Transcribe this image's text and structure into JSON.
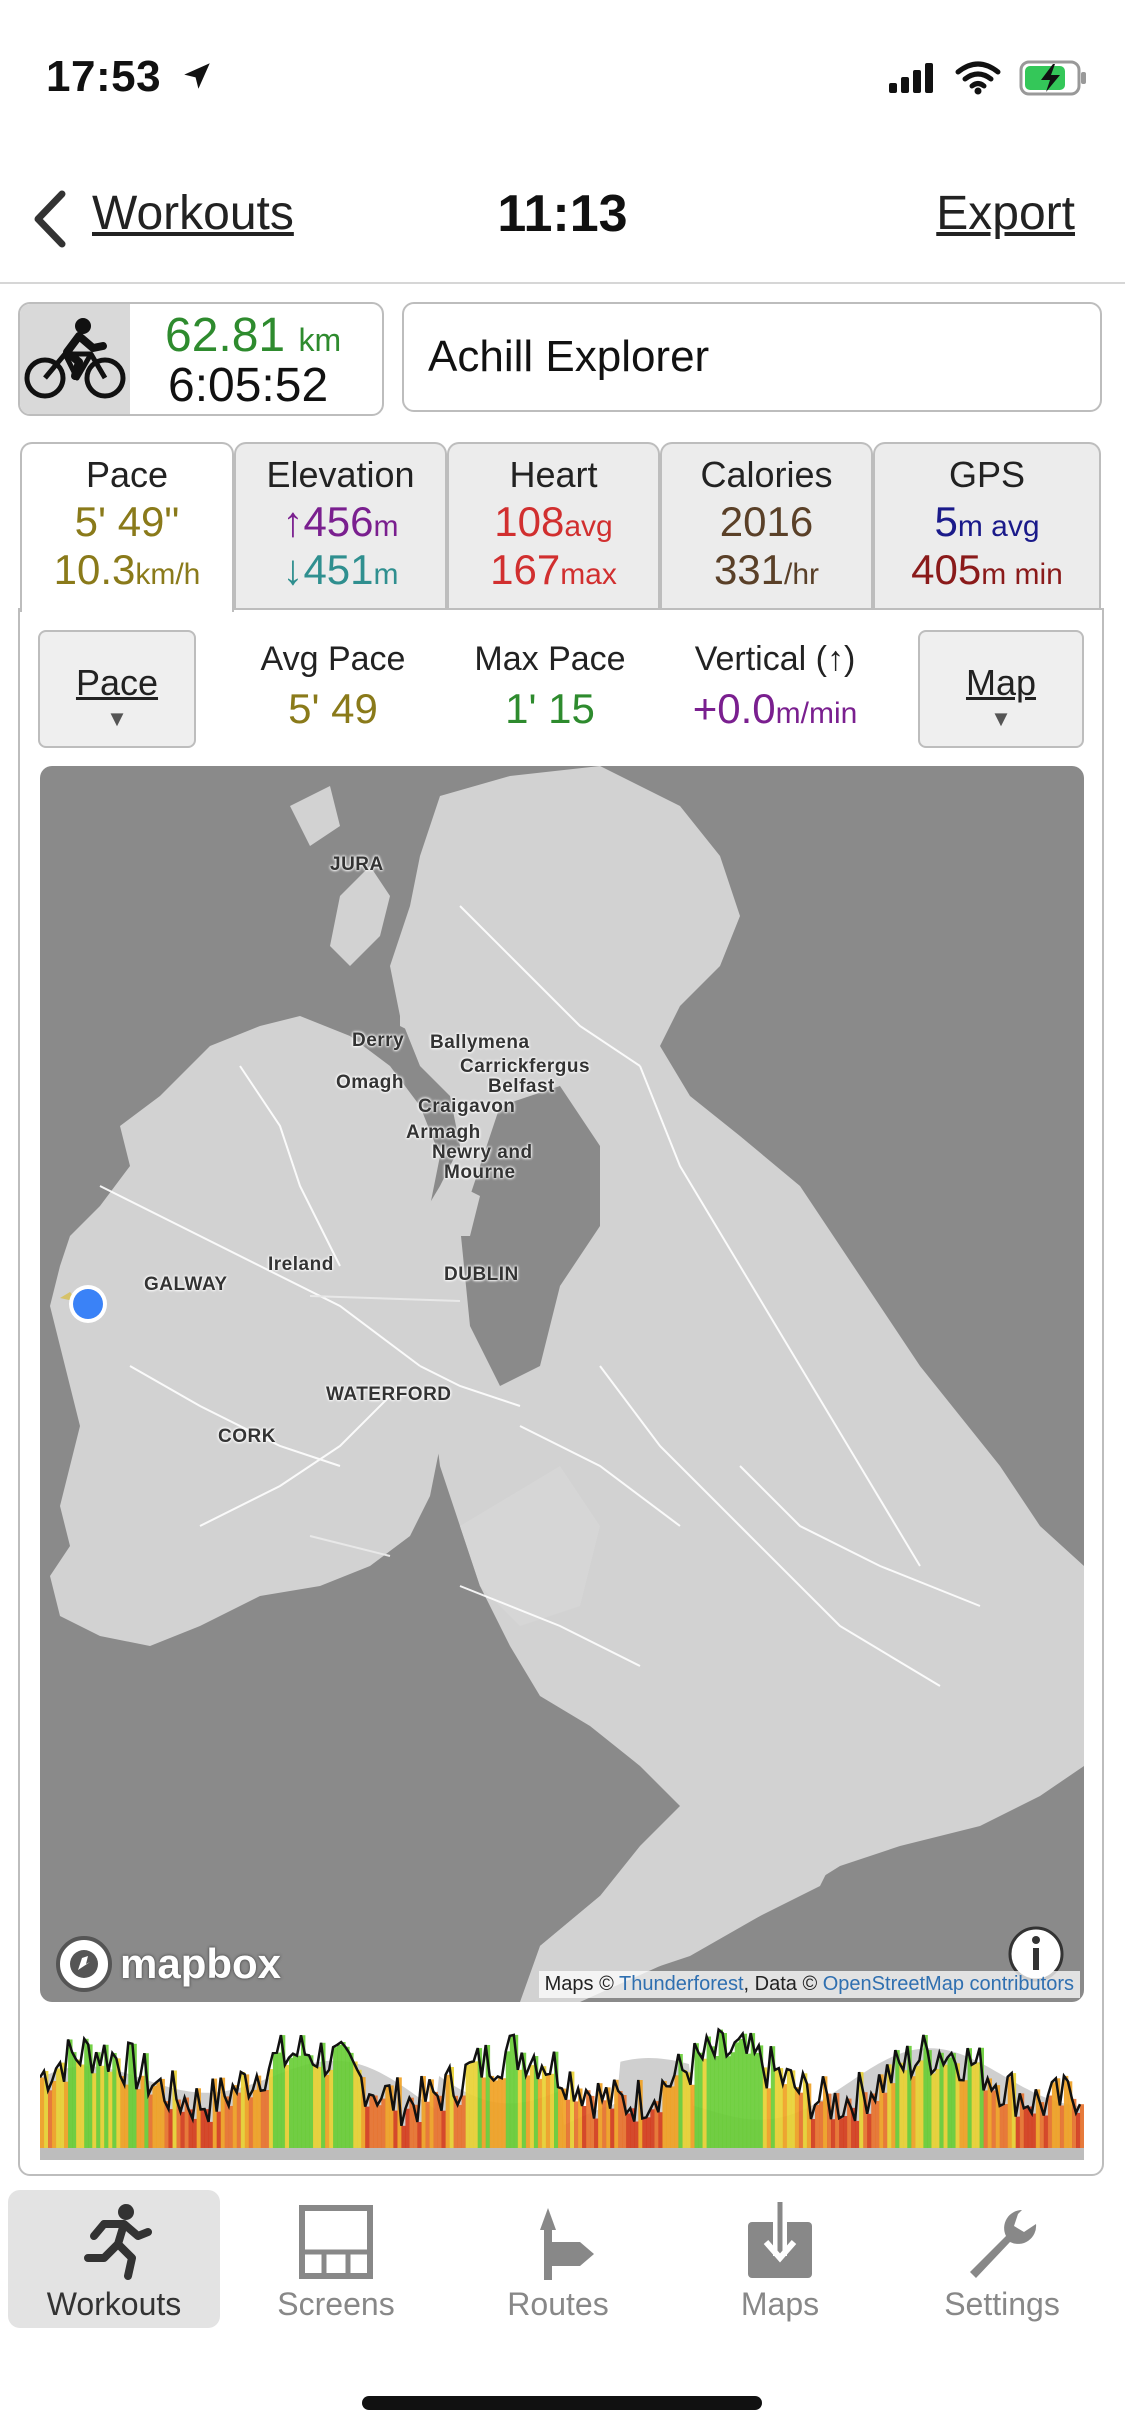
{
  "status_bar": {
    "time": "17:53"
  },
  "nav": {
    "back_label": "Workouts",
    "title": "11:13",
    "export_label": "Export"
  },
  "summary": {
    "distance_value": "62.81",
    "distance_unit": "km",
    "duration": "6:05:52",
    "workout_name": "Achill Explorer",
    "activity_icon": "cyclist-icon"
  },
  "tabs": [
    {
      "title": "Pace",
      "v1": "5' 49\"",
      "v1_unit": "",
      "v2": "10.3",
      "v2_unit": "km/h",
      "v1_color": "#8a7a1a",
      "v2_color": "#8a7a1a"
    },
    {
      "title": "Elevation",
      "v1": "↑456",
      "v1_unit": "m",
      "v2": "↓451",
      "v2_unit": "m",
      "v1_color": "#7a1f8f",
      "v2_color": "#2f8f8f"
    },
    {
      "title": "Heart",
      "v1": "108",
      "v1_unit": "avg",
      "v2": "167",
      "v2_unit": "max",
      "v1_color": "#d12f2f",
      "v2_color": "#d12f2f"
    },
    {
      "title": "Calories",
      "v1": "2016",
      "v1_unit": "",
      "v2": "331",
      "v2_unit": "/hr",
      "v1_color": "#5a4028",
      "v2_color": "#5a4028"
    },
    {
      "title": "GPS",
      "v1": "5",
      "v1_unit": "m avg",
      "v2": "405",
      "v2_unit": "m min",
      "v1_color": "#1a1a8a",
      "v2_color": "#8a1a1a"
    }
  ],
  "controls": {
    "left_button": "Pace",
    "right_button": "Map",
    "stats": [
      {
        "label": "Avg Pace",
        "value": "5' 49",
        "unit": "",
        "color": "#8a7a1a"
      },
      {
        "label": "Max Pace",
        "value": "1' 15",
        "unit": "",
        "color": "#2e8b2e"
      },
      {
        "label": "Vertical (↑)",
        "value": "+0.0",
        "unit": "m/min",
        "color": "#7a1f8f"
      }
    ]
  },
  "map": {
    "labels": [
      "JURA",
      "Derry",
      "Ballymena",
      "Carrickfergus",
      "Omagh",
      "Belfast",
      "Craigavon",
      "Armagh",
      "Newry and",
      "Mourne",
      "Ireland",
      "GALWAY",
      "DUBLIN",
      "WATERFORD",
      "CORK"
    ],
    "logo": "mapbox",
    "attribution_prefix": "Maps ©",
    "attribution_link1": "Thunderforest",
    "attribution_mid": ", Data ©",
    "attribution_link2": "OpenStreetMap contributors"
  },
  "tabbar": [
    {
      "label": "Workouts",
      "icon": "runner-icon",
      "selected": true
    },
    {
      "label": "Screens",
      "icon": "screens-icon",
      "selected": false
    },
    {
      "label": "Routes",
      "icon": "route-sign-icon",
      "selected": false
    },
    {
      "label": "Maps",
      "icon": "map-download-icon",
      "selected": false
    },
    {
      "label": "Settings",
      "icon": "wrench-icon",
      "selected": false
    }
  ],
  "colors": {
    "accent_green": "#2e8b2e",
    "land": "#d2d2d2",
    "sea": "#8a8a8a",
    "location_dot": "#3a82f7"
  }
}
